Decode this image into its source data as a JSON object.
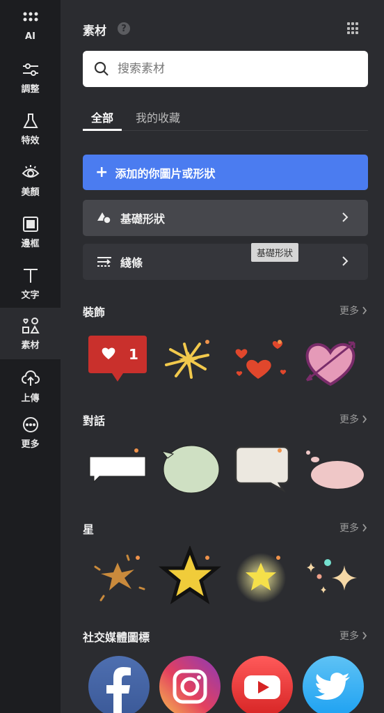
{
  "sidebar": {
    "items": [
      {
        "label": "AI",
        "icon": "ai-dots-icon"
      },
      {
        "label": "調整",
        "icon": "sliders-icon"
      },
      {
        "label": "特效",
        "icon": "flask-icon"
      },
      {
        "label": "美顏",
        "icon": "eye-icon"
      },
      {
        "label": "邊框",
        "icon": "frame-icon"
      },
      {
        "label": "文字",
        "icon": "text-icon"
      },
      {
        "label": "素材",
        "icon": "shapes-icon",
        "active": true
      },
      {
        "label": "上傳",
        "icon": "upload-cloud-icon"
      },
      {
        "label": "更多",
        "icon": "more-dots-icon"
      }
    ]
  },
  "header": {
    "title": "素材",
    "help": "?"
  },
  "search": {
    "placeholder": "搜索素材"
  },
  "tabs": [
    {
      "label": "全部"
    },
    {
      "label": "我的收藏"
    }
  ],
  "add_button": {
    "label": "添加的你圖片或形狀"
  },
  "basic_shapes": {
    "label": "基礎形狀"
  },
  "lines": {
    "label": "綫條"
  },
  "tooltip": {
    "text": "基礎形狀"
  },
  "sections": {
    "decoration": {
      "title": "裝飾",
      "more": "更多"
    },
    "dialogue": {
      "title": "對話",
      "more": "更多"
    },
    "star": {
      "title": "星",
      "more": "更多"
    },
    "social": {
      "title": "社交媒體圖標",
      "more": "更多"
    }
  },
  "notification_badge": {
    "count": "1"
  },
  "colors": {
    "accent": "#4b7cf0",
    "dot": "#f0934b",
    "bg": "#2b2c30",
    "sidebar": "#1c1d20"
  }
}
